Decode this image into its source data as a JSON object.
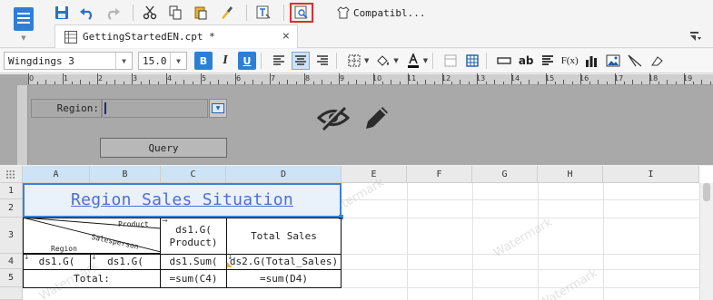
{
  "toolbar": {
    "compat_label": "Compatibl..."
  },
  "document_tab": {
    "title": "GettingStartedEN.cpt *",
    "close_glyph": "×"
  },
  "format_bar": {
    "font_name": "Wingdings 3",
    "font_size": "15.0",
    "bold": "B",
    "italic": "I",
    "underline": "U",
    "ab_label": "ab",
    "fx_label": "F(x)",
    "accent_color": "#2d7fd6"
  },
  "ruler": {
    "numbers": [
      "0",
      "1",
      "2",
      "3",
      "4",
      "5",
      "6",
      "7",
      "8",
      "9",
      "10",
      "11",
      "12",
      "13",
      "14",
      "15",
      "16",
      "17",
      "18",
      "19"
    ]
  },
  "parameter_pane": {
    "region_label": "Region:",
    "query_label": "Query"
  },
  "sheet": {
    "columns": [
      "A",
      "B",
      "C",
      "D",
      "E",
      "F",
      "G",
      "H",
      "I"
    ],
    "rows": [
      "1",
      "2",
      "3",
      "4",
      "5"
    ],
    "title": "Region Sales Situation",
    "header_product": "Product",
    "header_salesperson": "Salesperson",
    "header_region": "Region",
    "c3": "ds1.G(\nProduct)",
    "d3": "Total Sales",
    "a4": "ds1.G(",
    "b4": "ds1.G(",
    "c4": "ds1.Sum(",
    "d4": "ds2.G(Total_Sales)",
    "a5": "Total:",
    "c5": "=sum(C4)",
    "d5": "=sum(D4)",
    "watermark": "Watermark"
  }
}
